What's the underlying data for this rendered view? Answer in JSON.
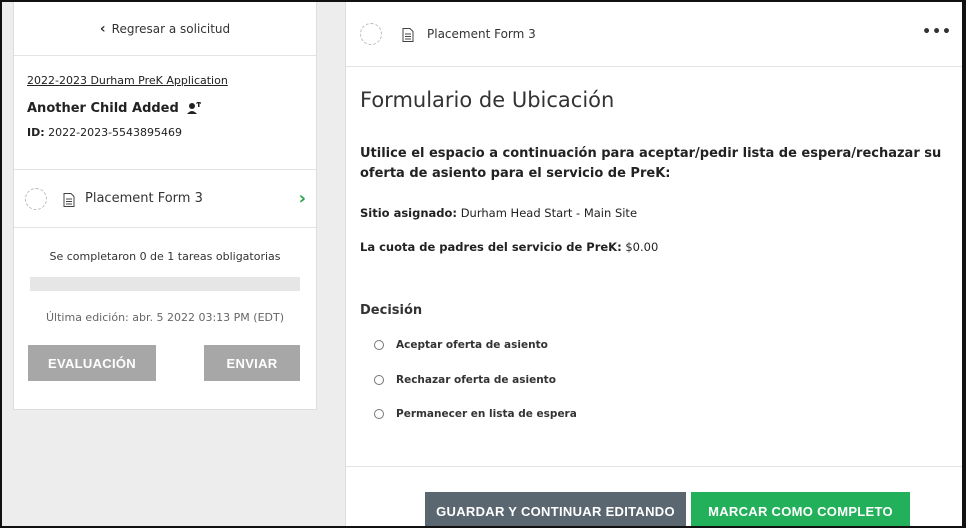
{
  "sidebar": {
    "back_label": "Regresar a solicitud",
    "application_title": "2022-2023 Durham PreK Application",
    "child_name": "Another Child Added",
    "id_label": "ID:",
    "id_value": "2022-2023-5543895469",
    "form_item_label": "Placement Form 3",
    "progress_text": "Se completaron 0 de 1 tareas obligatorias",
    "progress_fraction": 0,
    "last_edit": "Última edición: abr. 5 2022 03:13 PM (EDT)",
    "evaluation_button": "EVALUACIÓN",
    "submit_button": "ENVIAR"
  },
  "main": {
    "header_title": "Placement Form 3",
    "more_label": "•••",
    "form_title": "Formulario de Ubicación",
    "instructions": "Utilice el espacio a continuación para aceptar/pedir lista de espera/rechazar su oferta de asiento para el servicio de PreK:",
    "site_label": "Sitio asignado:",
    "site_value": "Durham Head Start - Main Site",
    "fee_label": "La cuota de padres del servicio de PreK:",
    "fee_value": "$0.00",
    "decision_label": "Decisión",
    "options": [
      "Aceptar oferta de asiento",
      "Rechazar oferta de asiento",
      "Permanecer en lista de espera"
    ],
    "save_button": "GUARDAR Y CONTINUAR EDITANDO",
    "complete_button": "MARCAR COMO COMPLETO"
  },
  "colors": {
    "accent_green": "#22b15a",
    "save_gray": "#5b6770",
    "disabled_gray": "#a7a7a7"
  }
}
